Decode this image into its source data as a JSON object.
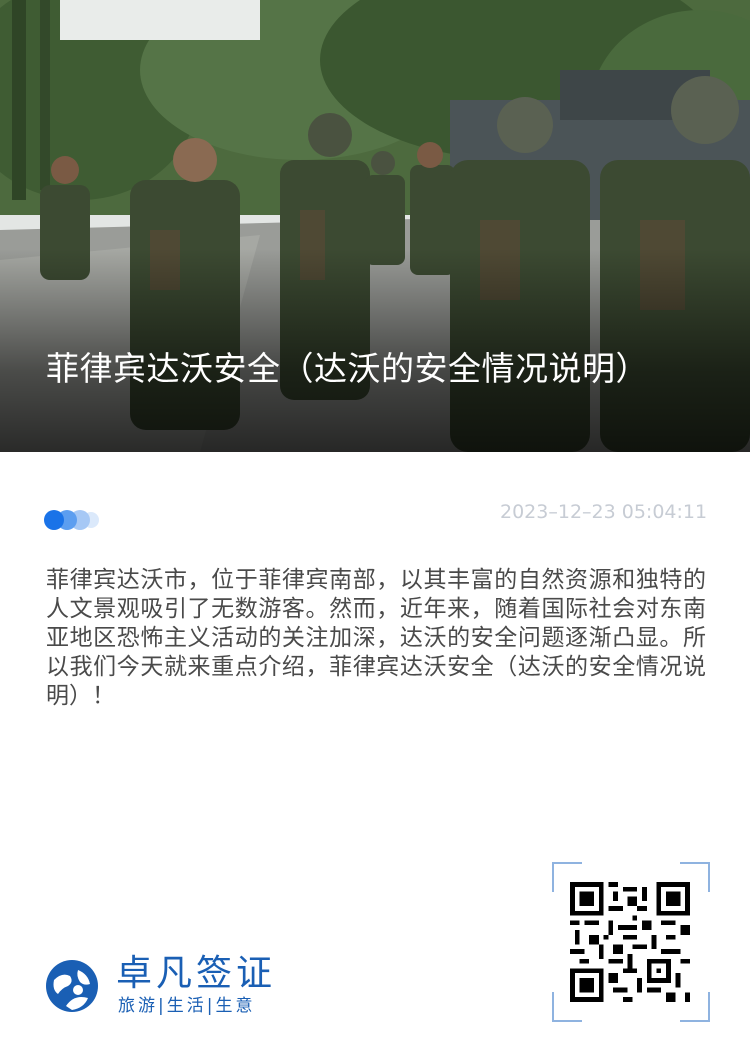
{
  "hero": {
    "title": "菲律宾达沃安全（达沃的安全情况说明）"
  },
  "meta": {
    "datetime": "2023–12–23  05:04:11",
    "accent_color": "#1a73e8"
  },
  "article": {
    "intro": "菲律宾达沃市，位于菲律宾南部，以其丰富的自然资源和独特的人文景观吸引了无数游客。然而，近年来，随着国际社会对东南亚地区恐怖主义活动的关注加深，达沃的安全问题逐渐凸显。所以我们今天就来重点介绍，菲律宾达沃安全（达沃的安全情况说明）！"
  },
  "brand": {
    "name": "卓凡签证",
    "tagline": "旅游|生活|生意",
    "color": "#1a5fb4",
    "logo_icon": "globe-person-icon"
  },
  "qr": {
    "icon": "qr-code-icon"
  }
}
